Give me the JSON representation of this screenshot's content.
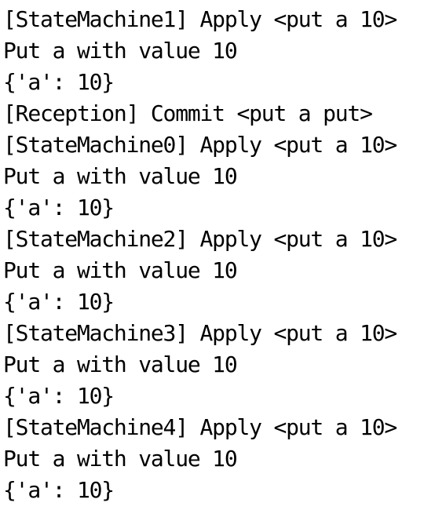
{
  "terminal": {
    "lines": [
      "[StateMachine1] Apply <put a 10>",
      "Put a with value 10",
      "{'a': 10}",
      "[Reception] Commit <put a put>",
      "[StateMachine0] Apply <put a 10>",
      "Put a with value 10",
      "{'a': 10}",
      "[StateMachine2] Apply <put a 10>",
      "Put a with value 10",
      "{'a': 10}",
      "[StateMachine3] Apply <put a 10>",
      "Put a with value 10",
      "{'a': 10}",
      "[StateMachine4] Apply <put a 10>",
      "Put a with value 10",
      "{'a': 10}"
    ]
  },
  "colors": {
    "background": "#ffffff",
    "text": "#000000"
  }
}
